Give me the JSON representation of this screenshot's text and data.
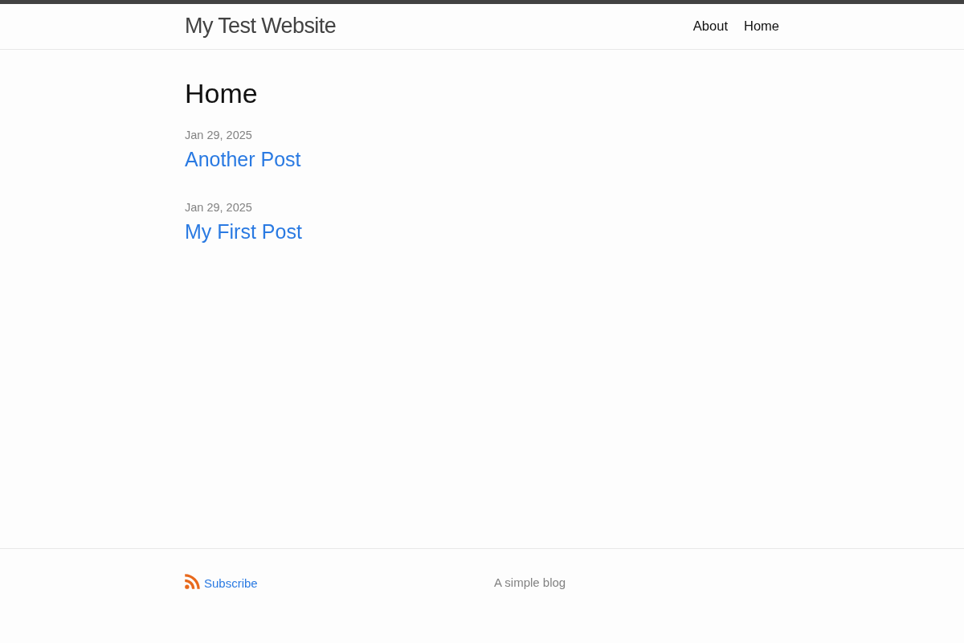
{
  "header": {
    "site_title": "My Test Website",
    "nav": [
      {
        "label": "About"
      },
      {
        "label": "Home"
      }
    ]
  },
  "page": {
    "title": "Home",
    "posts": [
      {
        "date": "Jan 29, 2025",
        "title": "Another Post"
      },
      {
        "date": "Jan 29, 2025",
        "title": "My First Post"
      }
    ]
  },
  "footer": {
    "subscribe": "Subscribe",
    "description": "A simple blog"
  }
}
